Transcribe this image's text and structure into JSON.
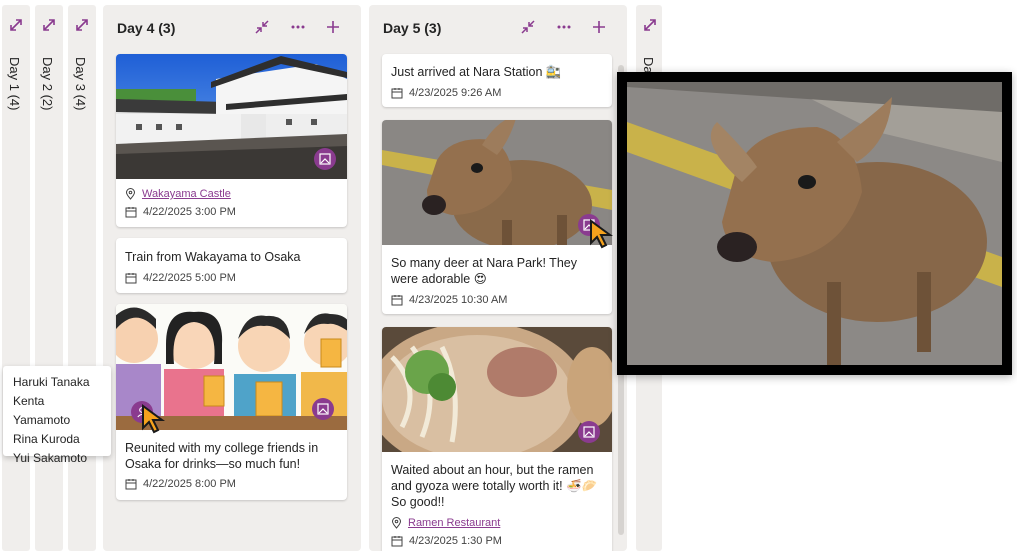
{
  "collapsed_columns": [
    {
      "label": "Day 1 (4)"
    },
    {
      "label": "Day 2 (2)"
    },
    {
      "label": "Day 3 (4)"
    }
  ],
  "day4": {
    "title": "Day 4 (3)",
    "cards": [
      {
        "image": "castle-photo",
        "location": "Wakayama Castle",
        "datetime": "4/22/2025 3:00 PM"
      },
      {
        "text": "Train from Wakayama to Osaka",
        "datetime": "4/22/2025 5:00 PM"
      },
      {
        "image": "friends-drinking-illustration",
        "text": "Reunited with my college friends in Osaka for drinks—so much fun!",
        "datetime": "4/22/2025 8:00 PM"
      }
    ]
  },
  "day5": {
    "title": "Day 5 (3)",
    "cards": [
      {
        "text": "Just arrived at Nara Station 🚉",
        "datetime": "4/23/2025 9:26 AM"
      },
      {
        "image": "deer-photo",
        "text": "So many deer at Nara Park! They were adorable 😍",
        "datetime": "4/23/2025 10:30 AM"
      },
      {
        "image": "ramen-photo",
        "text": "Waited about an hour, but the ramen and gyoza were totally worth it! 🍜🥟 So good!!",
        "location": "Ramen Restaurant",
        "datetime": "4/23/2025 1:30 PM"
      }
    ]
  },
  "day6_partial_label": "Day",
  "people_popup": [
    "Haruki Tanaka",
    "Kenta Yamamoto",
    "Rina Kuroda",
    "Yui Sakamoto"
  ],
  "colors": {
    "accent": "#8a3b8f",
    "column_bg": "#f0eeec"
  },
  "icons": [
    "expand-icon",
    "collapse-icon",
    "more-icon",
    "add-icon",
    "location-icon",
    "calendar-icon",
    "image-icon",
    "person-icon",
    "cursor-icon"
  ]
}
